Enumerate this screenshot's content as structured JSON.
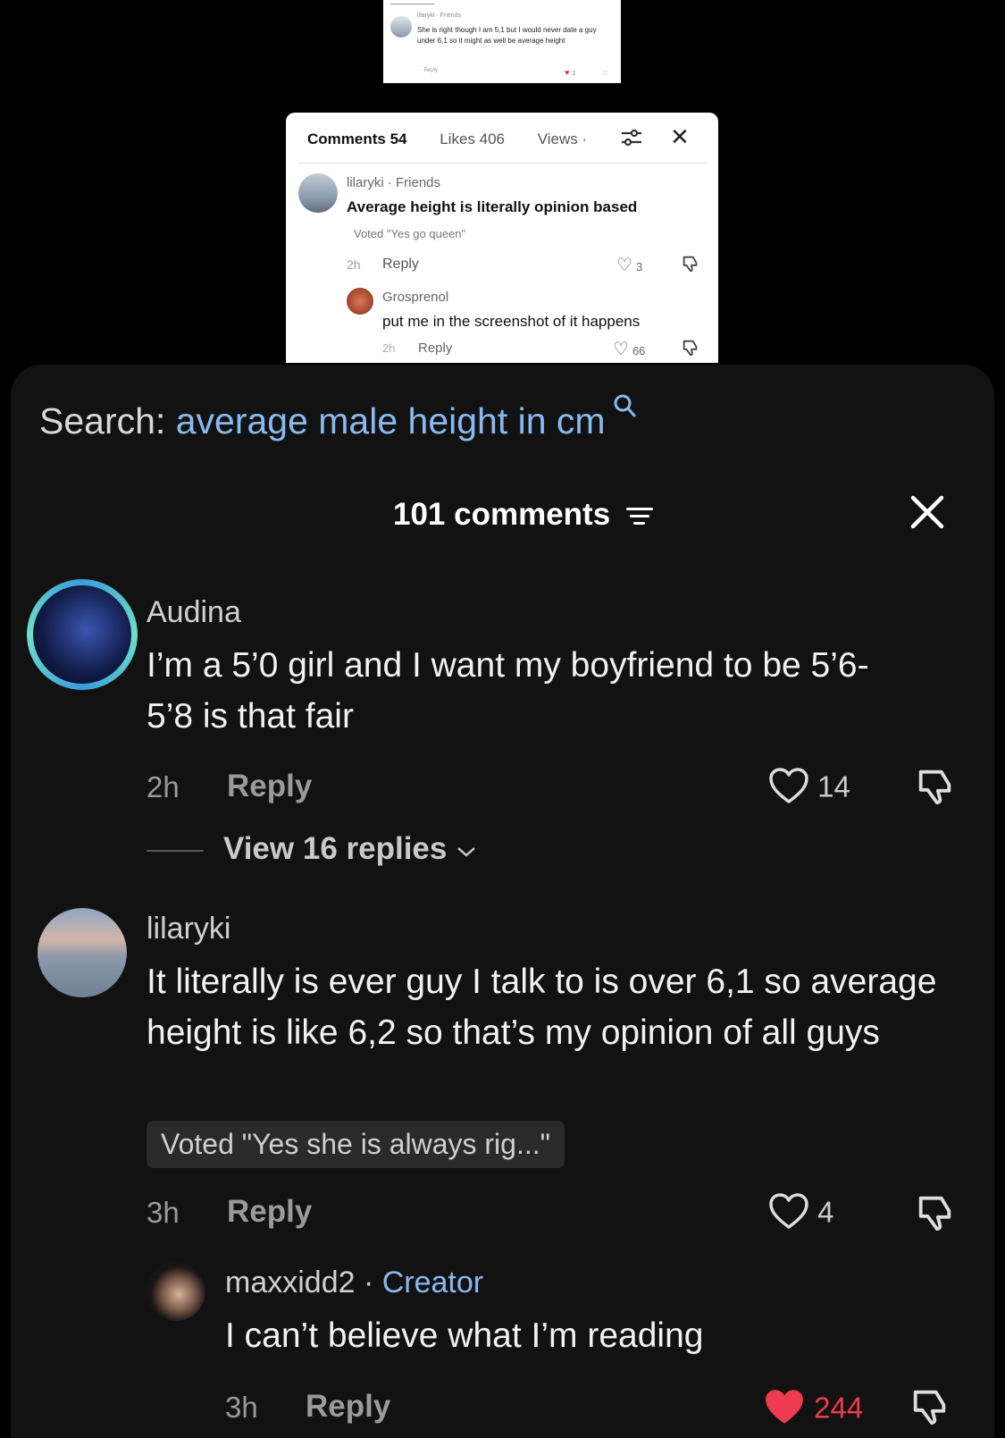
{
  "top_screenshot": {
    "username": "lilaryki · Friends",
    "comment": "She is right though I am 5,1 but I would never date a guy under 6,1 so it might as well be average height",
    "footer": "··· Reply",
    "likes": "2"
  },
  "inset_screenshot": {
    "tabs": [
      {
        "label": "Comments 54"
      },
      {
        "label": "Likes 406"
      },
      {
        "label": "Views ·"
      }
    ],
    "comments": [
      {
        "user": "lilaryki · Friends",
        "text": "Average height is literally opinion based",
        "vote": "Voted \"Yes go queen\"",
        "time": "2h",
        "reply": "Reply",
        "likes": "3"
      },
      {
        "user": "Grosprenol",
        "text": "put me in the screenshot of it happens",
        "time": "2h",
        "reply": "Reply",
        "likes": "66"
      }
    ]
  },
  "search": {
    "label": "Search:",
    "query": "average male height in cm"
  },
  "header": {
    "title": "101 comments"
  },
  "comments": [
    {
      "user": "Audina",
      "text": "I’m a 5’0 girl and I want my boyfriend to be 5’6-5’8 is that fair",
      "time": "2h",
      "reply": "Reply",
      "likes": "14",
      "view_replies": "View 16 replies"
    },
    {
      "user": "lilaryki",
      "text": "It literally is ever guy I talk to is over 6,1 so average height is like 6,2 so that’s my opinion of all guys",
      "vote": "Voted \"Yes she is always rig...\"",
      "time": "3h",
      "reply": "Reply",
      "likes": "4"
    }
  ],
  "reply_comment": {
    "user": "maxxidd2",
    "separator": " · ",
    "badge": "Creator",
    "text": "I can’t believe what I’m reading",
    "time": "3h",
    "reply": "Reply",
    "likes": "244",
    "liked": true
  },
  "colors": {
    "background": "#000000",
    "panel": "#121212",
    "accent_blue": "#8ab8f0",
    "liked_red": "#ee3b4f"
  }
}
